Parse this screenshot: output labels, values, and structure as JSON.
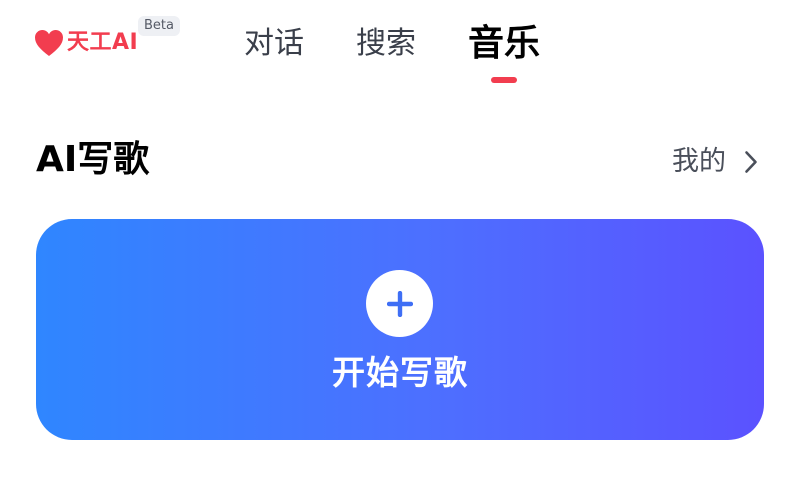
{
  "header": {
    "logo_text": "天工AI",
    "beta_label": "Beta",
    "icons": {
      "logo": "heart-icon"
    },
    "tabs": [
      {
        "label": "对话",
        "active": false
      },
      {
        "label": "搜索",
        "active": false
      },
      {
        "label": "音乐",
        "active": true
      }
    ]
  },
  "section": {
    "title": "AI写歌",
    "mine_label": "我的",
    "mine_icon": "chevron-right-icon"
  },
  "start_card": {
    "label": "开始写歌",
    "icon": "plus-icon"
  },
  "colors": {
    "brand_red": "#f23d4f",
    "card_gradient_start": "#2f86ff",
    "card_gradient_end": "#5b52ff",
    "plus_blue": "#3f6ff5"
  }
}
